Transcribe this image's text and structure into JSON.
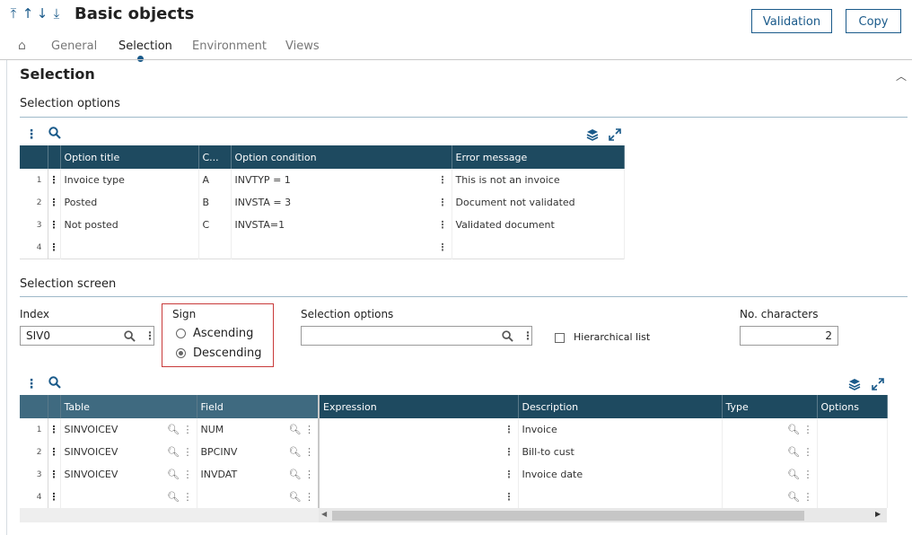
{
  "header": {
    "nav": [
      "⤒",
      "↑",
      "↓",
      "⤓"
    ],
    "title": "Basic objects",
    "buttons": {
      "validation": "Validation",
      "copy": "Copy"
    }
  },
  "tabs": {
    "home": "⌂",
    "general": "General",
    "selection": "Selection",
    "environment": "Environment",
    "views": "Views"
  },
  "section": {
    "title": "Selection",
    "collapse": "︿"
  },
  "selection_options": {
    "title": "Selection options",
    "columns": [
      "Option title",
      "C...",
      "Option condition",
      "Error message"
    ],
    "rows": [
      {
        "n": "1",
        "title": "Invoice type",
        "code": "A",
        "condition": "INVTYP = 1",
        "error": "This is not an invoice"
      },
      {
        "n": "2",
        "title": "Posted",
        "code": "B",
        "condition": "INVSTA = 3",
        "error": "Document not validated"
      },
      {
        "n": "3",
        "title": "Not posted",
        "code": "C",
        "condition": "INVSTA=1",
        "error": "Validated document"
      },
      {
        "n": "4",
        "title": "",
        "code": "",
        "condition": "",
        "error": ""
      }
    ]
  },
  "selection_screen": {
    "title": "Selection screen",
    "index_label": "Index",
    "index_value": "SIV0",
    "sign_label": "Sign",
    "sign_options": [
      "Ascending",
      "Descending"
    ],
    "sign_selected": "Descending",
    "sel_options_label": "Selection options",
    "sel_options_value": "",
    "hierarchical_label": "Hierarchical list",
    "nochars_label": "No. characters",
    "nochars_value": "2"
  },
  "fields_grid": {
    "columns": [
      "Table",
      "Field",
      "Expression",
      "Description",
      "Type",
      "Options"
    ],
    "rows": [
      {
        "n": "1",
        "table": "SINVOICEV",
        "field": "NUM",
        "expression": "",
        "description": "Invoice",
        "type": "",
        "options": ""
      },
      {
        "n": "2",
        "table": "SINVOICEV",
        "field": "BPCINV",
        "expression": "",
        "description": "Bill-to cust",
        "type": "",
        "options": ""
      },
      {
        "n": "3",
        "table": "SINVOICEV",
        "field": "INVDAT",
        "expression": "",
        "description": "Invoice date",
        "type": "",
        "options": ""
      },
      {
        "n": "4",
        "table": "",
        "field": "",
        "expression": "",
        "description": "",
        "type": "",
        "options": ""
      }
    ]
  },
  "colors": {
    "accent": "#1a5a8a",
    "grid_header": "#1e4a60",
    "highlight_border": "#c83a3a"
  }
}
